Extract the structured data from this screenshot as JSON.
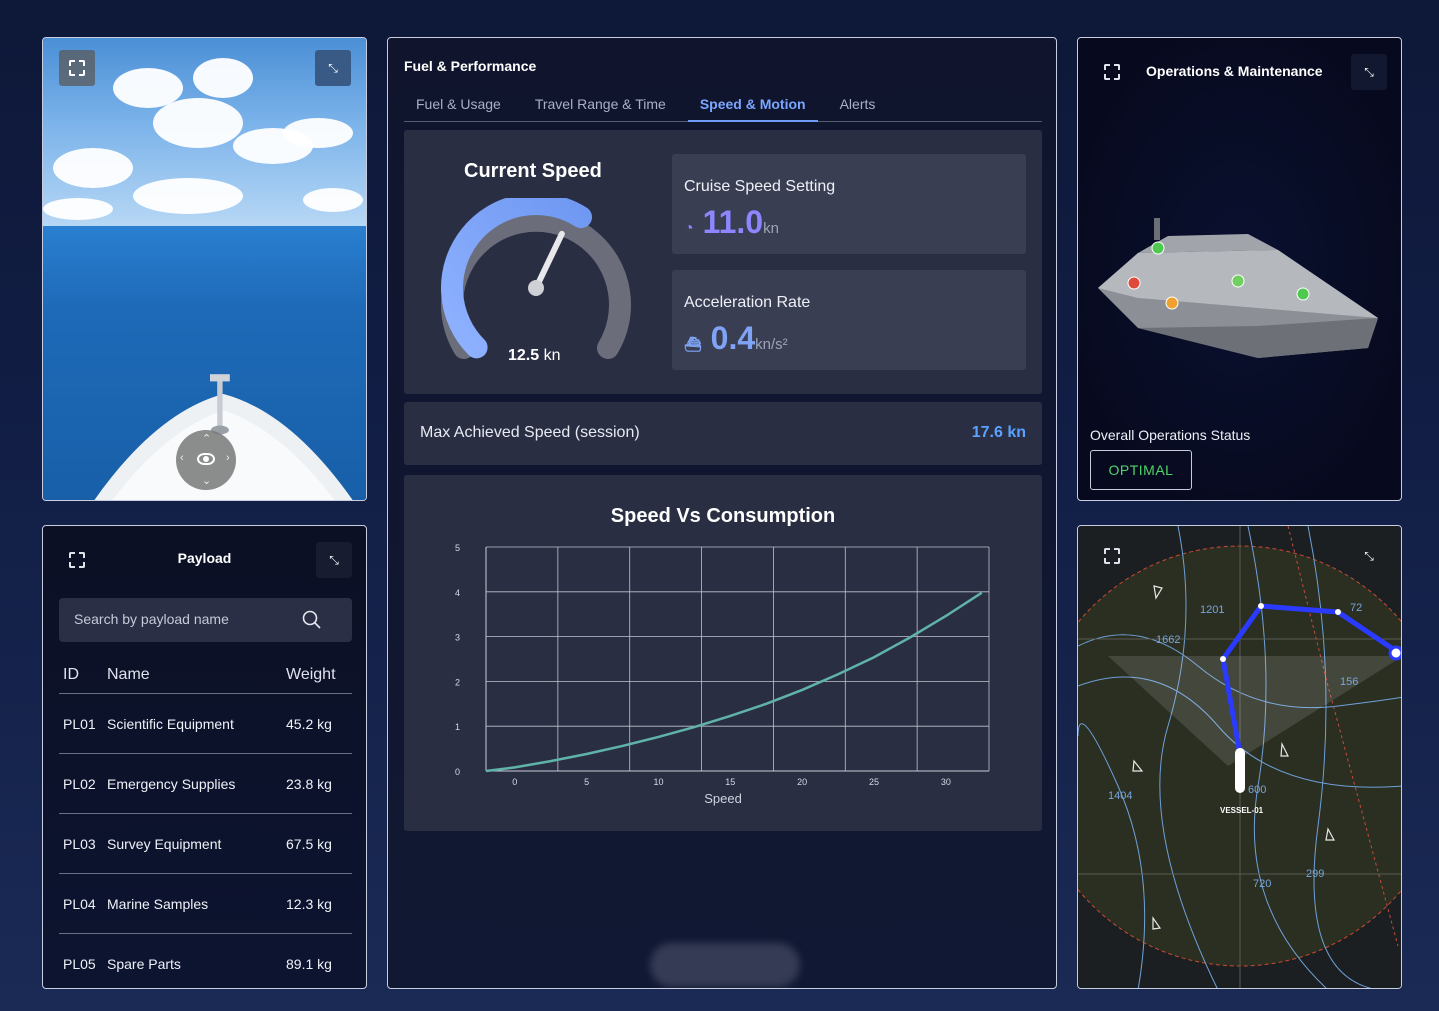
{
  "camera": {
    "fullscreen_icon": "fullscreen-icon",
    "minimize_icon": "minimize-icon",
    "joystick_icon": "eye-icon"
  },
  "payload": {
    "title": "Payload",
    "search_placeholder": "Search by payload name",
    "columns": [
      "ID",
      "Name",
      "Weight"
    ],
    "rows": [
      {
        "id": "PL01",
        "name": "Scientific Equipment",
        "weight": "45.2 kg"
      },
      {
        "id": "PL02",
        "name": "Emergency Supplies",
        "weight": "23.8 kg"
      },
      {
        "id": "PL03",
        "name": "Survey Equipment",
        "weight": "67.5 kg"
      },
      {
        "id": "PL04",
        "name": "Marine Samples",
        "weight": "12.3 kg"
      },
      {
        "id": "PL05",
        "name": "Spare Parts",
        "weight": "89.1 kg"
      }
    ]
  },
  "fuel": {
    "title": "Fuel & Performance",
    "tabs": [
      "Fuel & Usage",
      "Travel Range & Time",
      "Speed & Motion",
      "Alerts"
    ],
    "active_tab": "Speed & Motion",
    "current_speed": {
      "label": "Current Speed",
      "value": "12.5",
      "unit": "kn",
      "fraction": 0.62
    },
    "cruise": {
      "label": "Cruise Speed Setting",
      "value": "11.0",
      "unit": "kn"
    },
    "accel": {
      "label": "Acceleration Rate",
      "value": "0.4",
      "unit": "kn/s²"
    },
    "max_speed": {
      "label": "Max Achieved Speed (session)",
      "value": "17.6 kn"
    }
  },
  "chart_data": {
    "type": "line",
    "title": "Speed Vs Consumption",
    "xlabel": "Speed",
    "ylabel": "",
    "xlim": [
      -2,
      33
    ],
    "ylim": [
      0,
      5
    ],
    "x_ticks": [
      0,
      5,
      10,
      15,
      20,
      25,
      30
    ],
    "y_ticks": [
      0,
      1,
      2,
      3,
      4,
      5
    ],
    "grid": true,
    "series": [
      {
        "color": "#5fb3a9",
        "x": [
          -2,
          0,
          2.5,
          5,
          7.5,
          10,
          12.5,
          15,
          17.5,
          20,
          22.5,
          25,
          27.5,
          30,
          32.5
        ],
        "y": [
          0,
          0.08,
          0.22,
          0.38,
          0.56,
          0.76,
          0.98,
          1.23,
          1.5,
          1.81,
          2.16,
          2.54,
          2.98,
          3.46,
          3.98
        ]
      }
    ]
  },
  "ops": {
    "title": "Operations & Maintenance",
    "status_label": "Overall Operations Status",
    "status_value": "OPTIMAL",
    "status_color": "#4fd36a"
  },
  "map": {
    "labels": [
      "1201",
      "1662",
      "156",
      "1404",
      "720",
      "299",
      "600",
      "72"
    ],
    "vessel": "VESSEL-01",
    "route_color": "#2a3bff"
  }
}
